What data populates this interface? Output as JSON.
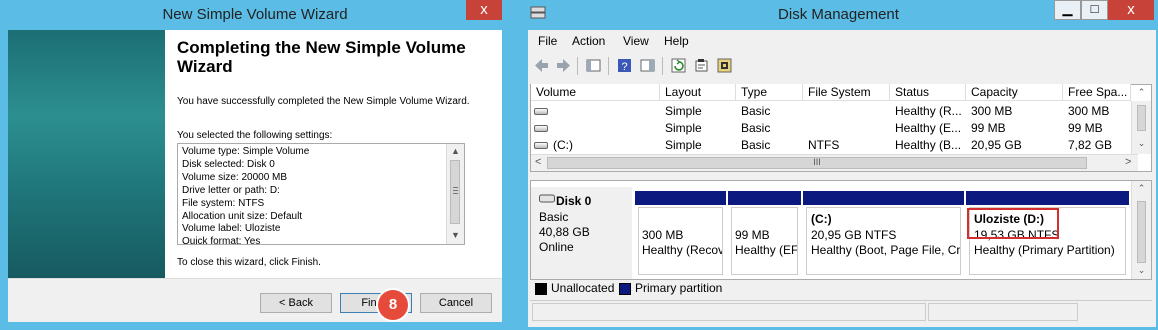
{
  "wizard": {
    "window_title": "New Simple Volume Wizard",
    "close_glyph": "x",
    "heading": "Completing the New Simple Volume Wizard",
    "success_text": "You have successfully completed the New Simple Volume Wizard.",
    "selected_text": "You selected the following settings:",
    "settings": [
      "Volume type: Simple Volume",
      "Disk selected: Disk 0",
      "Volume size: 20000 MB",
      "Drive letter or path: D:",
      "File system: NTFS",
      "Allocation unit size: Default",
      "Volume label: Uloziste",
      "Quick format: Yes"
    ],
    "close_text": "To close this wizard, click Finish.",
    "back_label": "< Back",
    "finish_label": "Finish",
    "cancel_label": "Cancel",
    "step_badge": "8"
  },
  "disk_mgmt": {
    "window_title": "Disk Management",
    "min_glyph": "▁",
    "max_glyph": "□",
    "close_glyph": "x",
    "menu": [
      "File",
      "Action",
      "View",
      "Help"
    ],
    "columns": [
      "Volume",
      "Layout",
      "Type",
      "File System",
      "Status",
      "Capacity",
      "Free Spa..."
    ],
    "volumes": [
      {
        "volume": "",
        "layout": "Simple",
        "type": "Basic",
        "fs": "",
        "status": "Healthy (R...",
        "capacity": "300 MB",
        "free": "300 MB"
      },
      {
        "volume": "",
        "layout": "Simple",
        "type": "Basic",
        "fs": "",
        "status": "Healthy (E...",
        "capacity": "99 MB",
        "free": "99 MB"
      },
      {
        "volume": "(C:)",
        "layout": "Simple",
        "type": "Basic",
        "fs": "NTFS",
        "status": "Healthy (B...",
        "capacity": "20,95 GB",
        "free": "7,82 GB"
      }
    ],
    "hscroll_thumb": "III",
    "disk": {
      "name": "Disk 0",
      "type": "Basic",
      "size": "40,88 GB",
      "state": "Online"
    },
    "partitions": [
      {
        "label": "",
        "size": "300 MB",
        "status": "Healthy (Recov"
      },
      {
        "label": "",
        "size": "99 MB",
        "status": "Healthy (EF"
      },
      {
        "label": "(C:)",
        "size": "20,95 GB NTFS",
        "status": "Healthy (Boot, Page File, Cra"
      },
      {
        "label": "Uloziste  (D:)",
        "size": "19,53 GB NTFS",
        "status": "Healthy (Primary Partition)"
      }
    ],
    "legend": {
      "unallocated": "Unallocated",
      "primary": "Primary partition",
      "unallocated_color": "#000000",
      "primary_color": "#0c1a80"
    }
  }
}
